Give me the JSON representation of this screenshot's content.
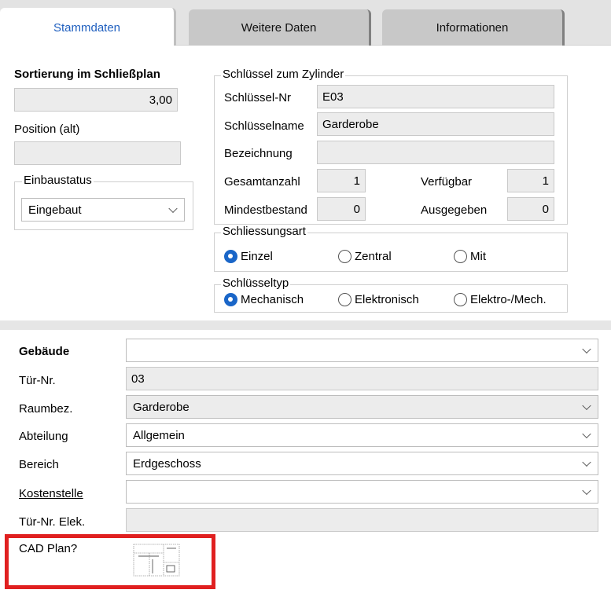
{
  "tabs": [
    {
      "label": "Stammdaten",
      "active": true
    },
    {
      "label": "Weitere Daten",
      "active": false
    },
    {
      "label": "Informationen",
      "active": false
    }
  ],
  "left": {
    "sort_label": "Sortierung im Schließplan",
    "sort_value": "3,00",
    "position_label": "Position (alt)",
    "position_value": "",
    "einbau_legend": "Einbaustatus",
    "einbau_value": "Eingebaut"
  },
  "key": {
    "legend": "Schlüssel zum Zylinder",
    "nr_label": "Schlüssel-Nr",
    "nr_value": "E03",
    "name_label": "Schlüsselname",
    "name_value": "Garderobe",
    "bez_label": "Bezeichnung",
    "bez_value": "",
    "gesamt_label": "Gesamtanzahl",
    "gesamt_value": "1",
    "verf_label": "Verfügbar",
    "verf_value": "1",
    "mindest_label": "Mindestbestand",
    "mindest_value": "0",
    "ausg_label": "Ausgegeben",
    "ausg_value": "0"
  },
  "schliessungsart": {
    "legend": "Schliessungsart",
    "options": [
      "Einzel",
      "Zentral",
      "Mit"
    ],
    "selected": 0
  },
  "schluesseltyp": {
    "legend": "Schlüsseltyp",
    "options": [
      "Mechanisch",
      "Elektronisch",
      "Elektro-/Mech."
    ],
    "selected": 0
  },
  "lower": {
    "gebaeude_label": "Gebäude",
    "gebaeude_value": "",
    "tuernr_label": "Tür-Nr.",
    "tuernr_value": "03",
    "raum_label": "Raumbez.",
    "raum_value": "Garderobe",
    "abteilung_label": "Abteilung",
    "abteilung_value": "Allgemein",
    "bereich_label": "Bereich",
    "bereich_value": "Erdgeschoss",
    "kosten_label": "Kostenstelle",
    "kosten_value": "",
    "tuerelek_label": "Tür-Nr. Elek.",
    "tuerelek_value": "",
    "cad_label": "CAD Plan?"
  },
  "colors": {
    "accent": "#1a66c8",
    "tab_active_text": "#1f5fbf",
    "highlight": "#e02020"
  }
}
